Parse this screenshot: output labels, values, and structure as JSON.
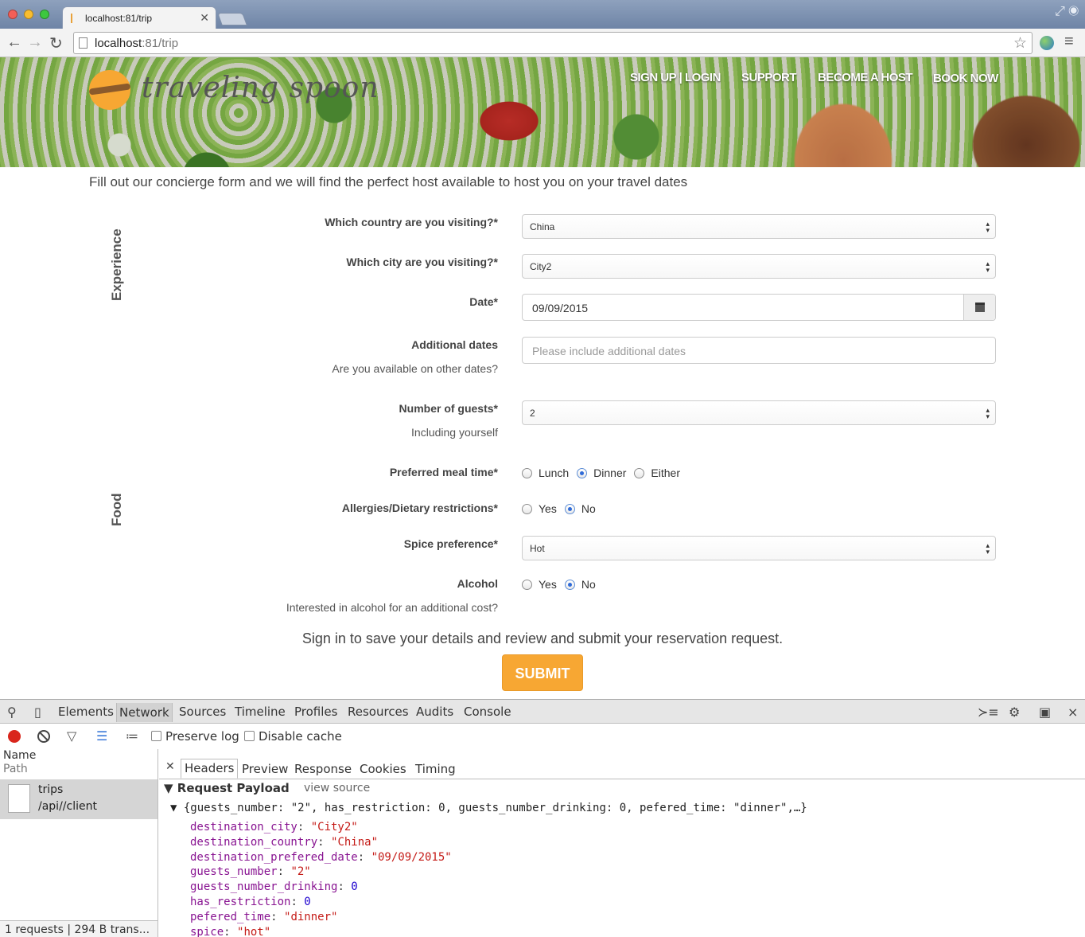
{
  "browser": {
    "tab_title": "localhost:81/trip",
    "url_host": "localhost",
    "url_rest": ":81/trip"
  },
  "header": {
    "logo_text": "traveling spoon",
    "nav": [
      "SIGN UP | LOGIN",
      "SUPPORT",
      "BECOME A HOST",
      "BOOK NOW"
    ]
  },
  "form": {
    "intro": "Fill out our concierge form and we will find the perfect host available to host you on your travel dates",
    "sections": {
      "experience": "Experience",
      "food": "Food"
    },
    "country": {
      "label": "Which country are you visiting?*",
      "value": "China"
    },
    "city": {
      "label": "Which city are you visiting?*",
      "value": "City2"
    },
    "date": {
      "label": "Date*",
      "value": "09/09/2015"
    },
    "additional_dates": {
      "label": "Additional dates",
      "help": "Are you available on other dates?",
      "placeholder": "Please include additional dates"
    },
    "guests": {
      "label": "Number of guests*",
      "help": "Including yourself",
      "value": "2"
    },
    "meal_time": {
      "label": "Preferred meal time*",
      "options": [
        "Lunch",
        "Dinner",
        "Either"
      ],
      "selected": "Dinner"
    },
    "allergies": {
      "label": "Allergies/Dietary restrictions*",
      "options": [
        "Yes",
        "No"
      ],
      "selected": "No"
    },
    "spice": {
      "label": "Spice preference*",
      "value": "Hot"
    },
    "alcohol": {
      "label": "Alcohol",
      "help": "Interested in alcohol for an additional cost?",
      "options": [
        "Yes",
        "No"
      ],
      "selected": "No"
    },
    "cta": "Sign in to save your details and review and submit your reservation request.",
    "submit": "SUBMIT"
  },
  "devtools": {
    "tabs": [
      "Elements",
      "Network",
      "Sources",
      "Timeline",
      "Profiles",
      "Resources",
      "Audits",
      "Console"
    ],
    "active_tab": "Network",
    "preserve_log": "Preserve log",
    "disable_cache": "Disable cache",
    "col_name": "Name",
    "col_path": "Path",
    "request": {
      "name": "trips",
      "path": "/api//client"
    },
    "summary": "1 requests | 294 B trans...",
    "sub_tabs": [
      "Headers",
      "Preview",
      "Response",
      "Cookies",
      "Timing"
    ],
    "payload_title": "Request Payload",
    "view_source": "view source",
    "object_summary": "{guests_number: \"2\", has_restriction: 0, guests_number_drinking: 0, pefered_time: \"dinner\",…}",
    "properties": [
      {
        "key": "destination_city",
        "value": "\"City2\"",
        "type": "s"
      },
      {
        "key": "destination_country",
        "value": "\"China\"",
        "type": "s"
      },
      {
        "key": "destination_prefered_date",
        "value": "\"09/09/2015\"",
        "type": "s"
      },
      {
        "key": "guests_number",
        "value": "\"2\"",
        "type": "s"
      },
      {
        "key": "guests_number_drinking",
        "value": "0",
        "type": "n"
      },
      {
        "key": "has_restriction",
        "value": "0",
        "type": "n"
      },
      {
        "key": "pefered_time",
        "value": "\"dinner\"",
        "type": "s"
      },
      {
        "key": "spice",
        "value": "\"hot\"",
        "type": "s"
      }
    ]
  }
}
